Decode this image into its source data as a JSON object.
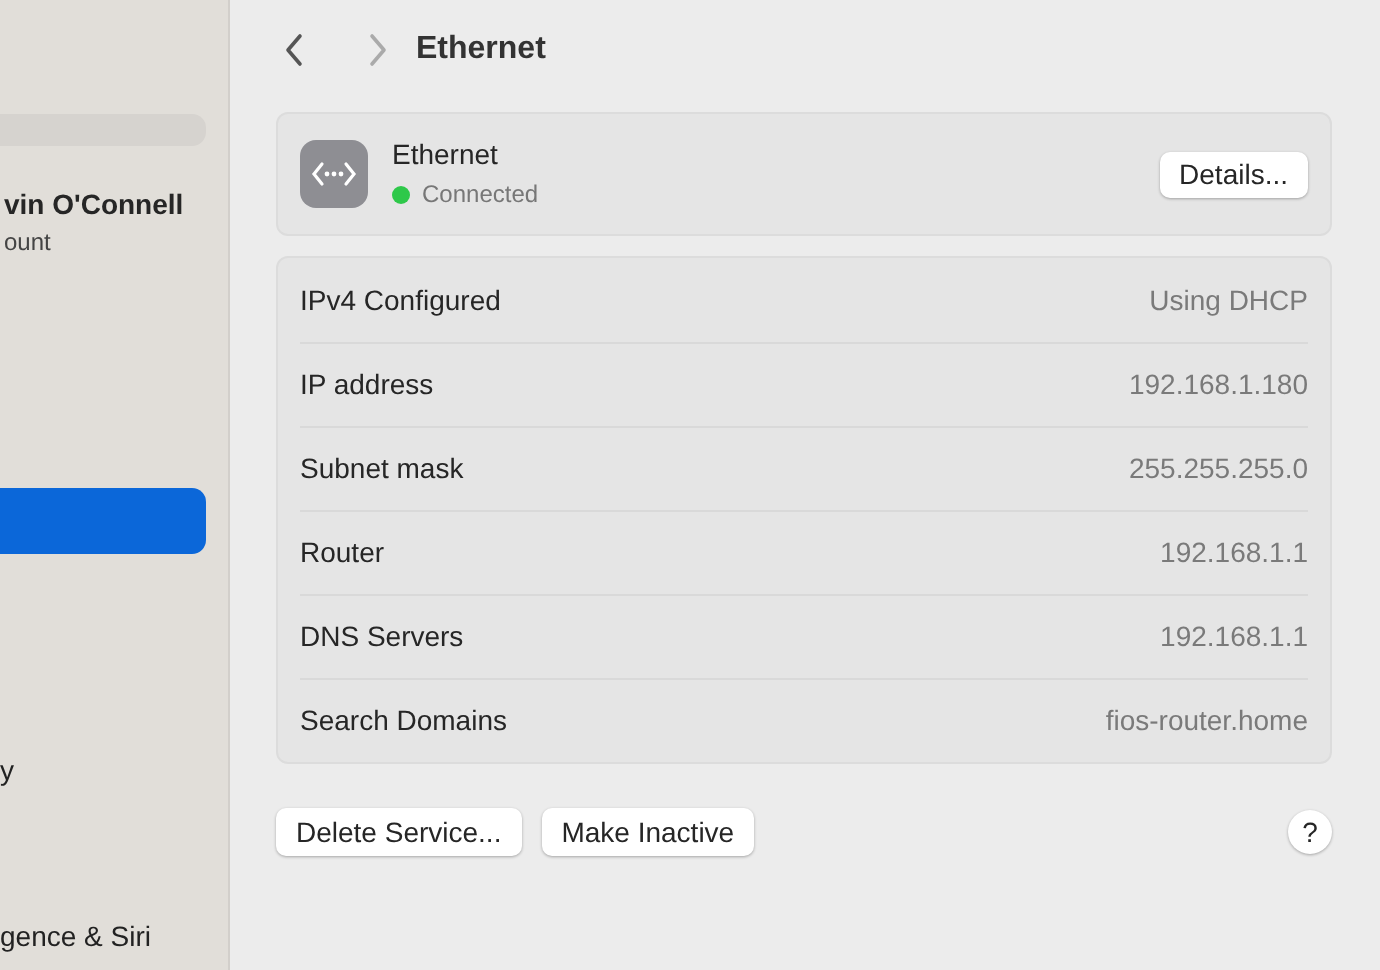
{
  "sidebar": {
    "account": {
      "name": "vin O'Connell",
      "subtitle": "ount"
    },
    "items": [
      {
        "selected": true
      },
      {
        "label": "y",
        "selected": false
      },
      {
        "label": "gence & Siri",
        "selected": false
      }
    ]
  },
  "toolbar": {
    "back_disabled": false,
    "forward_disabled": true,
    "title": "Ethernet"
  },
  "service": {
    "name": "Ethernet",
    "status": {
      "label": "Connected",
      "color": "#2ec84a"
    },
    "details_button": "Details..."
  },
  "details": [
    {
      "label": "IPv4 Configured",
      "value": "Using DHCP"
    },
    {
      "label": "IP address",
      "value": "192.168.1.180"
    },
    {
      "label": "Subnet mask",
      "value": "255.255.255.0"
    },
    {
      "label": "Router",
      "value": "192.168.1.1"
    },
    {
      "label": "DNS Servers",
      "value": "192.168.1.1"
    },
    {
      "label": "Search Domains",
      "value": "fios-router.home"
    }
  ],
  "buttons": [
    "Delete Service...",
    "Make Inactive"
  ],
  "help": "?"
}
